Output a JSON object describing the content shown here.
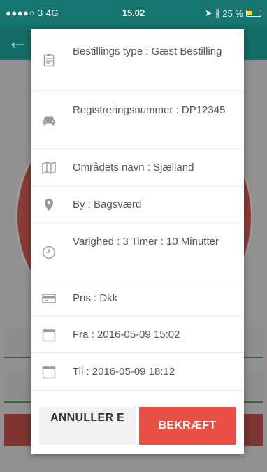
{
  "status_bar": {
    "carrier": "●●●●○ 3  4G",
    "time": "15.02",
    "battery": "25 %"
  },
  "dialog": {
    "rows": [
      {
        "icon": "clipboard-icon",
        "text": "Bestillings type : Gæst Bestilling"
      },
      {
        "icon": "car-icon",
        "text": "Registreringsnummer : DP12345"
      },
      {
        "icon": "map-icon",
        "text": "Områdets navn : Sjælland"
      },
      {
        "icon": "location-pin-icon",
        "text": "By : Bagsværd"
      },
      {
        "icon": "clock-icon",
        "text": "Varighed : 3 Timer : 10 Minutter"
      },
      {
        "icon": "credit-card-icon",
        "text": "Pris : Dkk"
      },
      {
        "icon": "calendar-icon",
        "text": "Fra : 2016-05-09 15:02"
      },
      {
        "icon": "calendar-icon",
        "text": "Til : 2016-05-09 18:12"
      }
    ],
    "cancel_label": "ANNULLER E",
    "confirm_label": "BEKRÆFT"
  }
}
